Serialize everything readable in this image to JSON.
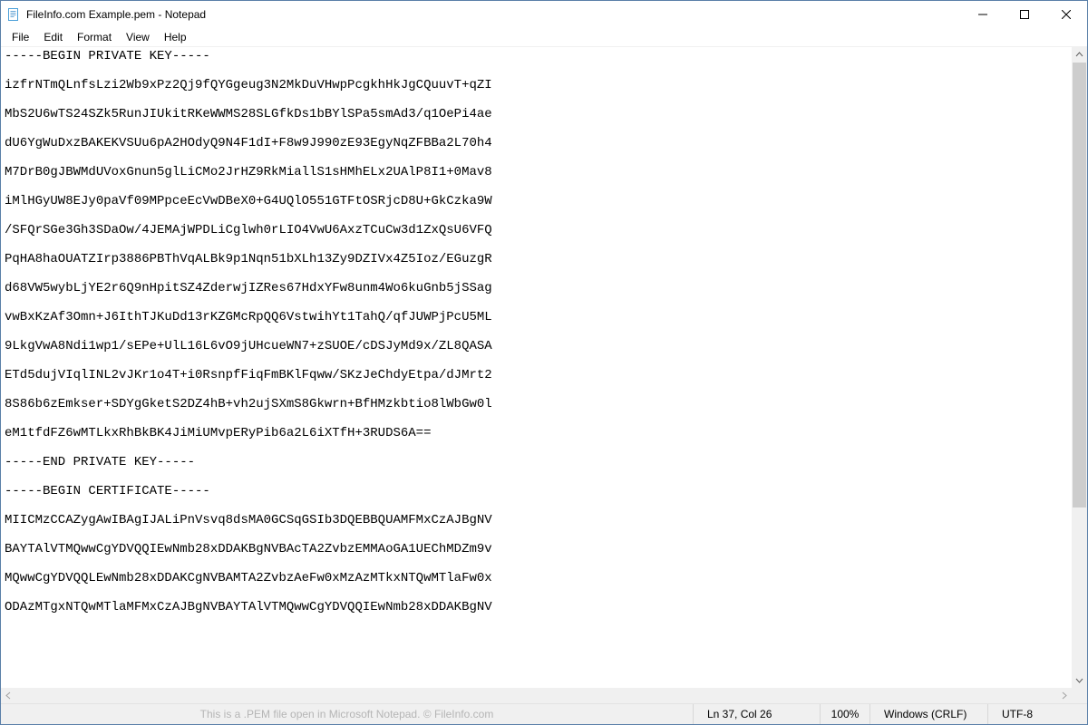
{
  "title": "FileInfo.com Example.pem - Notepad",
  "menu": {
    "file": "File",
    "edit": "Edit",
    "format": "Format",
    "view": "View",
    "help": "Help"
  },
  "content": "-----BEGIN PRIVATE KEY-----\n\nizfrNTmQLnfsLzi2Wb9xPz2Qj9fQYGgeug3N2MkDuVHwpPcgkhHkJgCQuuvT+qZI\n\nMbS2U6wTS24SZk5RunJIUkitRKeWWMS28SLGfkDs1bBYlSPa5smAd3/q1OePi4ae\n\ndU6YgWuDxzBAKEKVSUu6pA2HOdyQ9N4F1dI+F8w9J990zE93EgyNqZFBBa2L70h4\n\nM7DrB0gJBWMdUVoxGnun5glLiCMo2JrHZ9RkMiallS1sHMhELx2UAlP8I1+0Mav8\n\niMlHGyUW8EJy0paVf09MPpceEcVwDBeX0+G4UQlO551GTFtOSRjcD8U+GkCzka9W\n\n/SFQrSGe3Gh3SDaOw/4JEMAjWPDLiCglwh0rLIO4VwU6AxzTCuCw3d1ZxQsU6VFQ\n\nPqHA8haOUATZIrp3886PBThVqALBk9p1Nqn51bXLh13Zy9DZIVx4Z5Ioz/EGuzgR\n\nd68VW5wybLjYE2r6Q9nHpitSZ4ZderwjIZRes67HdxYFw8unm4Wo6kuGnb5jSSag\n\nvwBxKzAf3Omn+J6IthTJKuDd13rKZGMcRpQQ6VstwihYt1TahQ/qfJUWPjPcU5ML\n\n9LkgVwA8Ndi1wp1/sEPe+UlL16L6vO9jUHcueWN7+zSUOE/cDSJyMd9x/ZL8QASA\n\nETd5dujVIqlINL2vJKr1o4T+i0RsnpfFiqFmBKlFqww/SKzJeChdyEtpa/dJMrt2\n\n8S86b6zEmkser+SDYgGketS2DZ4hB+vh2ujSXmS8Gkwrn+BfHMzkbtio8lWbGw0l\n\neM1tfdFZ6wMTLkxRhBkBK4JiMiUMvpERyPib6a2L6iXTfH+3RUDS6A==\n\n-----END PRIVATE KEY-----\n\n-----BEGIN CERTIFICATE-----\n\nMIICMzCCAZygAwIBAgIJALiPnVsvq8dsMA0GCSqGSIb3DQEBBQUAMFMxCzAJBgNV\n\nBAYTAlVTMQwwCgYDVQQIEwNmb28xDDAKBgNVBAcTA2ZvbzEMMAoGA1UEChMDZm9v\n\nMQwwCgYDVQQLEwNmb28xDDAKCgNVBAMTA2ZvbzAeFw0xMzAzMTkxNTQwMTlaFw0x\n\nODAzMTgxNTQwMTlaMFMxCzAJBgNVBAYTAlVTMQwwCgYDVQQIEwNmb28xDDAKBgNV",
  "status": {
    "caption": "This is a .PEM file open in Microsoft Notepad. © FileInfo.com",
    "position": "Ln 37, Col 26",
    "zoom": "100%",
    "eol": "Windows (CRLF)",
    "encoding": "UTF-8"
  }
}
